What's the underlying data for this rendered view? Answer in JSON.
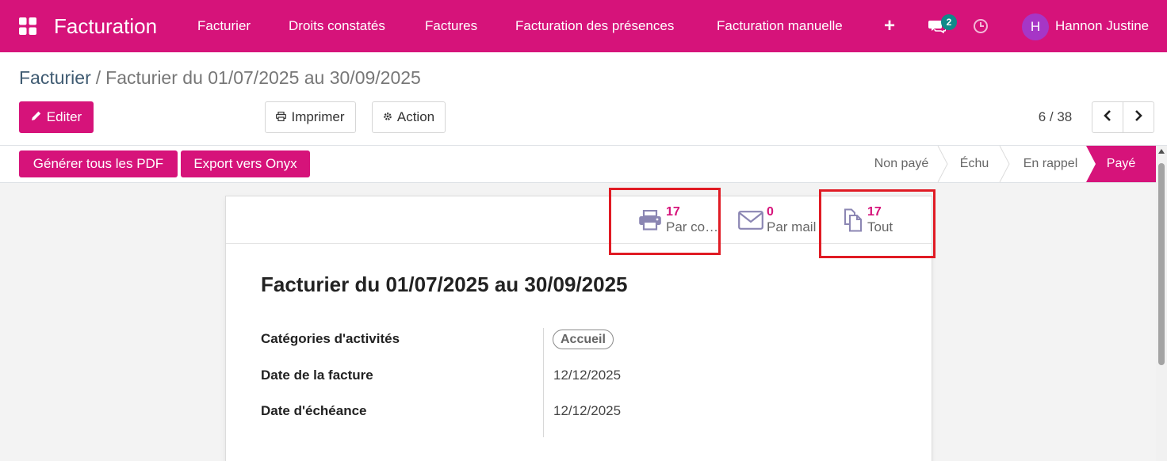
{
  "navbar": {
    "apps_icon": "grid-icon",
    "brand": "Facturation",
    "menu": [
      "Facturier",
      "Droits constatés",
      "Factures",
      "Facturation des présences",
      "Facturation manuelle"
    ],
    "add_icon": "plus-icon",
    "chat_icon": "chat-icon",
    "chat_count": "2",
    "clock_icon": "clock-icon",
    "avatar_initial": "H",
    "user_name": "Hannon Justine"
  },
  "breadcrumb": {
    "parent": "Facturier",
    "separator": "/",
    "current": "Facturier du 01/07/2025 au 30/09/2025"
  },
  "toolbar": {
    "edit_label": "Editer",
    "print_label": "Imprimer",
    "action_label": "Action"
  },
  "pager": {
    "value": "6 / 38"
  },
  "statusbar": {
    "buttons": [
      "Générer tous les PDF",
      "Export vers Onyx"
    ],
    "stages": [
      "Non payé",
      "Échu",
      "En rappel",
      "Payé"
    ],
    "active_stage": "Payé"
  },
  "smart_buttons": [
    {
      "value": "17",
      "label": "Par co…",
      "icon": "printer-icon"
    },
    {
      "value": "0",
      "label": "Par mail",
      "icon": "envelope-icon"
    },
    {
      "value": "17",
      "label": "Tout",
      "icon": "copy-icon"
    }
  ],
  "record": {
    "title": "Facturier du 01/07/2025 au 30/09/2025",
    "fields": [
      {
        "label": "Catégories d'activités",
        "value": "Accueil"
      },
      {
        "label": "Date de la facture",
        "value": "12/12/2025"
      },
      {
        "label": "Date d'échéance",
        "value": "12/12/2025"
      }
    ]
  },
  "colors": {
    "brand": "#d6137a",
    "badge": "#0f8a8a",
    "avatar": "#a636c6",
    "highlight": "#e01b24"
  }
}
